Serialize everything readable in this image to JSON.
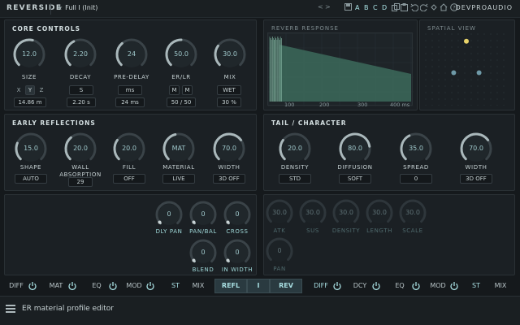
{
  "topbar": {
    "title": "REVERSIDE",
    "preset_name": "Full I (Init)",
    "preset_star": "★",
    "nav_left": "<",
    "nav_right": ">",
    "ab_buttons": [
      "A",
      "B",
      "C",
      "D"
    ],
    "brand": "DEVPROAUDIO"
  },
  "core": {
    "title": "CORE CONTROLS",
    "knobs": [
      {
        "label": "SIZE",
        "value": "12.0",
        "level": 0.55
      },
      {
        "label": "DECAY",
        "value": "2.20",
        "level": 0.4
      },
      {
        "label": "PRE-DELAY",
        "value": "24",
        "level": 0.35
      },
      {
        "label": "ER/LR",
        "value": "50.0",
        "level": 0.5
      },
      {
        "label": "MIX",
        "value": "30.0",
        "level": 0.3
      }
    ],
    "axes": [
      "X",
      "Y",
      "Z"
    ],
    "size_readout": "14.86 m",
    "decay_unit": "S",
    "decay_readout": "2.20 s",
    "predelay_unit": "ms",
    "predelay_readout": "24 ms",
    "erlr_m1": "M",
    "erlr_m2": "M",
    "erlr_readout": "50 / 50",
    "mix_mode": "WET",
    "mix_readout": "30 %"
  },
  "reverb": {
    "title": "REVERB RESPONSE",
    "ticks": [
      "100",
      "200",
      "300",
      "400 ms"
    ],
    "accent": "#3c6a5a"
  },
  "spatial": {
    "title": "SPATIAL VIEW",
    "points": [
      {
        "x": 0.5,
        "y": 0.12,
        "color": "#e8d36a"
      },
      {
        "x": 0.35,
        "y": 0.55,
        "color": "#6f9aa8"
      },
      {
        "x": 0.65,
        "y": 0.55,
        "color": "#6f9aa8"
      }
    ]
  },
  "early": {
    "title": "EARLY REFLECTIONS",
    "knobs": [
      {
        "label": "SHAPE",
        "value": "15.0",
        "level": 0.25,
        "box": "AUTO"
      },
      {
        "label": "WALL ABSORPTION",
        "value": "20.0",
        "level": 0.35,
        "box": "29"
      },
      {
        "label": "FILL",
        "value": "20.0",
        "level": 0.3,
        "box": "OFF"
      },
      {
        "label": "MATERIAL",
        "value": "MAT",
        "level": 0.45,
        "box": "LIVE"
      },
      {
        "label": "WIDTH",
        "value": "70.0",
        "level": 0.7,
        "box": "3D OFF"
      }
    ]
  },
  "tail": {
    "title": "TAIL / CHARACTER",
    "knobs": [
      {
        "label": "DENSITY",
        "value": "20.0",
        "level": 0.3,
        "box": "STD"
      },
      {
        "label": "DIFFUSION",
        "value": "80.0",
        "level": 0.8,
        "box": "SOFT"
      },
      {
        "label": "SPREAD",
        "value": "35.0",
        "level": 0.4,
        "box": "0"
      },
      {
        "label": "WIDTH",
        "value": "70.0",
        "level": 0.7,
        "box": "3D OFF"
      }
    ]
  },
  "panmix": {
    "knobs": [
      {
        "label": "DLY PAN",
        "value": "0",
        "level": 0.0
      },
      {
        "label": "PAN/BAL",
        "value": "0",
        "level": 0.0
      },
      {
        "label": "CROSS",
        "value": "0",
        "level": 0.0
      },
      {
        "label": "BLEND",
        "value": "0",
        "level": 0.0
      },
      {
        "label": "IN WIDTH",
        "value": "0",
        "level": 0.0
      }
    ]
  },
  "dyn": {
    "knobs": [
      {
        "label": "ATK",
        "value": "30.0"
      },
      {
        "label": "SUS",
        "value": "30.0"
      },
      {
        "label": "DENSITY",
        "value": "30.0"
      },
      {
        "label": "LENGTH",
        "value": "30.0"
      },
      {
        "label": "SCALE",
        "value": "30.0"
      },
      {
        "label": "PAN",
        "value": "0"
      }
    ]
  },
  "strip_left": [
    "DIFF",
    "MAT",
    "EQ",
    "MOD",
    "ST",
    "MIX"
  ],
  "strip_mid": [
    "REFL",
    "I",
    "REV"
  ],
  "strip_right": [
    "DIFF",
    "DCY",
    "EQ",
    "MOD",
    "ST",
    "MIX"
  ],
  "status": {
    "text": "ER material profile editor"
  }
}
